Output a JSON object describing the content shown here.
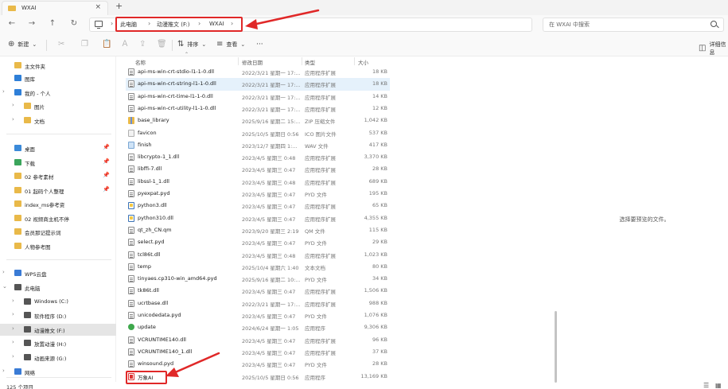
{
  "window": {
    "tab_title": "WXAI",
    "new_tab": "+",
    "close": "×"
  },
  "nav": {
    "back": "←",
    "forward": "→",
    "up": "↑",
    "refresh": "↻"
  },
  "address": {
    "crumbs": [
      "此电脑",
      "动漫推文 (F:)",
      "WXAI"
    ],
    "separator": "›"
  },
  "search": {
    "placeholder": "在 WXAI 中搜索"
  },
  "commands": {
    "new": "新建",
    "sort": "排序",
    "view": "查看",
    "more": "···",
    "details": "详细信息"
  },
  "sidebar": {
    "items": [
      {
        "label": "主文件夹",
        "chevron": ""
      },
      {
        "label": "图库",
        "chevron": ""
      },
      {
        "label": "我的 - 个人",
        "chevron": "›"
      },
      {
        "label": "图片",
        "chevron": "›"
      },
      {
        "label": "文档",
        "chevron": "›"
      },
      {
        "label": "桌面",
        "chevron": "",
        "pin": "📌"
      },
      {
        "label": "下载",
        "chevron": "",
        "pin": "📌"
      },
      {
        "label": "02 参考素材",
        "chevron": "",
        "pin": "📌"
      },
      {
        "label": "01 起码个人整理",
        "chevron": "",
        "pin": "📌"
      },
      {
        "label": "index_ms参考资",
        "chevron": ""
      },
      {
        "label": "02 视频商主机不停",
        "chevron": ""
      },
      {
        "label": "会员那记提示词",
        "chevron": ""
      },
      {
        "label": "人物参考图",
        "chevron": ""
      },
      {
        "label": "WPS云盘",
        "chevron": "›"
      },
      {
        "label": "此电脑",
        "chevron": "⌄"
      },
      {
        "label": "Windows (C:)",
        "chevron": "›"
      },
      {
        "label": "软件程序 (D:)",
        "chevron": "›"
      },
      {
        "label": "动漫推文 (F:)",
        "chevron": "›"
      },
      {
        "label": "放置动漫 (H:)",
        "chevron": "›"
      },
      {
        "label": "动画来源 (G:)",
        "chevron": "›"
      },
      {
        "label": "网络",
        "chevron": "›"
      }
    ]
  },
  "columns": {
    "name": "名称",
    "date": "修改日期",
    "type": "类型",
    "size": "大小"
  },
  "files": [
    {
      "name": "api-ms-win-crt-stdio-l1-1-0.dll",
      "date": "2022/3/21 星期一 17:...",
      "type": "应用程序扩展",
      "size": "18 KB",
      "icon": "doc"
    },
    {
      "name": "api-ms-win-crt-string-l1-1-0.dll",
      "date": "2022/3/21 星期一 17:...",
      "type": "应用程序扩展",
      "size": "18 KB",
      "icon": "doc"
    },
    {
      "name": "api-ms-win-crt-time-l1-1-0.dll",
      "date": "2022/3/21 星期一 17:...",
      "type": "应用程序扩展",
      "size": "14 KB",
      "icon": "doc"
    },
    {
      "name": "api-ms-win-crt-utility-l1-1-0.dll",
      "date": "2022/3/21 星期一 17:...",
      "type": "应用程序扩展",
      "size": "12 KB",
      "icon": "doc"
    },
    {
      "name": "base_library",
      "date": "2025/9/16 星期二 15:...",
      "type": "ZIP 压缩文件",
      "size": "1,042 KB",
      "icon": "zip"
    },
    {
      "name": "favicon",
      "date": "2025/10/5 星期日 0:56",
      "type": "ICO 图片文件",
      "size": "537 KB",
      "icon": "ico"
    },
    {
      "name": "finish",
      "date": "2023/12/7 星期四 1:...",
      "type": "WAV 文件",
      "size": "417 KB",
      "icon": "wav"
    },
    {
      "name": "libcrypto-1_1.dll",
      "date": "2023/4/5 星期三 0:48",
      "type": "应用程序扩展",
      "size": "3,370 KB",
      "icon": "doc"
    },
    {
      "name": "libffi-7.dll",
      "date": "2023/4/5 星期三 0:47",
      "type": "应用程序扩展",
      "size": "28 KB",
      "icon": "doc"
    },
    {
      "name": "libssl-1_1.dll",
      "date": "2023/4/5 星期三 0:48",
      "type": "应用程序扩展",
      "size": "689 KB",
      "icon": "doc"
    },
    {
      "name": "pyexpat.pyd",
      "date": "2023/4/5 星期三 0:47",
      "type": "PYD 文件",
      "size": "195 KB",
      "icon": "doc"
    },
    {
      "name": "python3.dll",
      "date": "2023/4/5 星期三 0:47",
      "type": "应用程序扩展",
      "size": "65 KB",
      "icon": "py"
    },
    {
      "name": "python310.dll",
      "date": "2023/4/5 星期三 0:47",
      "type": "应用程序扩展",
      "size": "4,355 KB",
      "icon": "py"
    },
    {
      "name": "qt_zh_CN.qm",
      "date": "2023/9/20 星期三 2:19",
      "type": "QM 文件",
      "size": "115 KB",
      "icon": "doc"
    },
    {
      "name": "select.pyd",
      "date": "2023/4/5 星期三 0:47",
      "type": "PYD 文件",
      "size": "29 KB",
      "icon": "doc"
    },
    {
      "name": "tcl86t.dll",
      "date": "2023/4/5 星期三 0:48",
      "type": "应用程序扩展",
      "size": "1,023 KB",
      "icon": "doc"
    },
    {
      "name": "temp",
      "date": "2025/10/4 星期六 1:40",
      "type": "文本文档",
      "size": "80 KB",
      "icon": "doc"
    },
    {
      "name": "tinyaes.cp310-win_amd64.pyd",
      "date": "2025/9/16 星期二 10:...",
      "type": "PYD 文件",
      "size": "34 KB",
      "icon": "doc"
    },
    {
      "name": "tk86t.dll",
      "date": "2023/4/5 星期三 0:47",
      "type": "应用程序扩展",
      "size": "1,506 KB",
      "icon": "doc"
    },
    {
      "name": "ucrtbase.dll",
      "date": "2022/3/21 星期一 17:...",
      "type": "应用程序扩展",
      "size": "988 KB",
      "icon": "doc"
    },
    {
      "name": "unicodedata.pyd",
      "date": "2023/4/5 星期三 0:47",
      "type": "PYD 文件",
      "size": "1,076 KB",
      "icon": "doc"
    },
    {
      "name": "update",
      "date": "2024/6/24 星期一 1:05",
      "type": "应用程序",
      "size": "9,306 KB",
      "icon": "exe-green"
    },
    {
      "name": "VCRUNTIME140.dll",
      "date": "2023/4/5 星期三 0:47",
      "type": "应用程序扩展",
      "size": "96 KB",
      "icon": "doc"
    },
    {
      "name": "VCRUNTIME140_1.dll",
      "date": "2023/4/5 星期三 0:47",
      "type": "应用程序扩展",
      "size": "37 KB",
      "icon": "doc"
    },
    {
      "name": "winsound.pyd",
      "date": "2023/4/5 星期三 0:47",
      "type": "PYD 文件",
      "size": "28 KB",
      "icon": "doc"
    },
    {
      "name": "万象AI",
      "date": "2025/10/5 星期日 0:56",
      "type": "应用程序",
      "size": "13,169 KB",
      "icon": "exe-app"
    }
  ],
  "preview": {
    "message": "选择要预览的文件。"
  },
  "status": {
    "count": "125 个项目"
  },
  "colors": {
    "annotation": "#e02828",
    "selection": "#e5f1fb",
    "folder": "#e9b949"
  }
}
